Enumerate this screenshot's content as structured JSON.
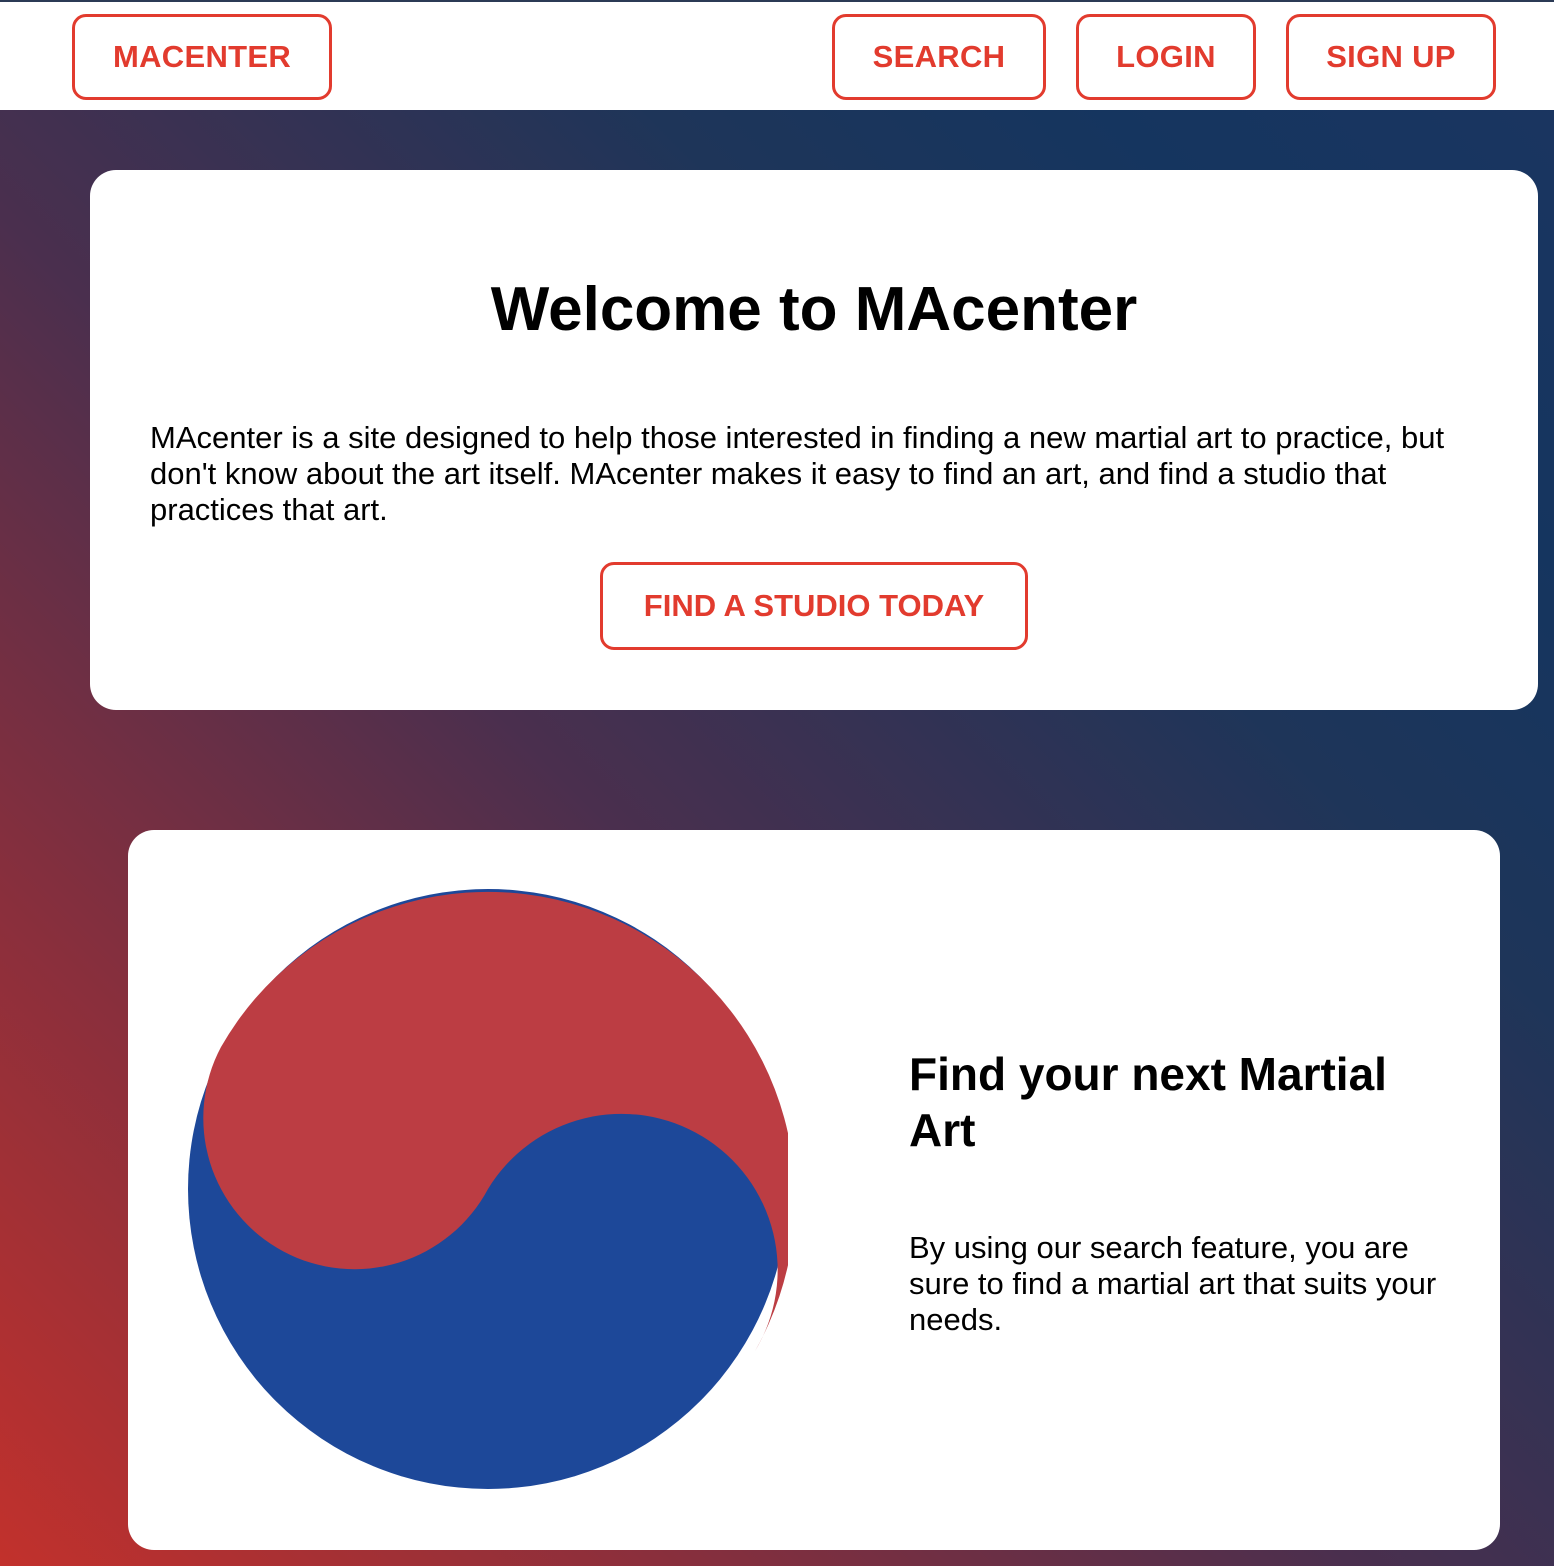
{
  "nav": {
    "brand": "MACENTER",
    "search": "SEARCH",
    "login": "LOGIN",
    "signup": "SIGN UP"
  },
  "welcome": {
    "title": "Welcome to MAcenter",
    "text": "MAcenter is a site designed to help those interested in finding a new martial art to practice, but don't know about the art itself. MAcenter makes it easy to find an art, and find a studio that practices that art.",
    "cta": "FIND A STUDIO TODAY"
  },
  "feature": {
    "image_icon": "taeguk-yin-yang-icon",
    "title": "Find your next Martial Art",
    "text": "By using our search feature, you are sure to find a martial art that suits your needs."
  },
  "colors": {
    "accent": "#e23b2e",
    "taeguk_red": "#bc3d43",
    "taeguk_blue": "#1d4899",
    "gradient_red": "#c2312c",
    "gradient_navy": "#15355f"
  }
}
